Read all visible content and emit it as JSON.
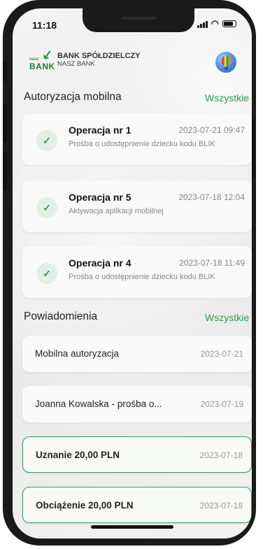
{
  "status": {
    "time": "11:18"
  },
  "bank": {
    "logo_small": "nasz",
    "logo_big": "BANK",
    "name": "BANK SPÓŁDZIELCZY",
    "sub": "NASZ BANK"
  },
  "auth": {
    "title": "Autoryzacja mobilna",
    "link": "Wszystkie",
    "items": [
      {
        "title": "Operacja nr 1",
        "date": "2023-07-21 09:47",
        "desc": "Prośba o udostępnienie dziecku kodu BLIK",
        "status_icon": "check-icon"
      },
      {
        "title": "Operacja nr 5",
        "date": "2023-07-18 12:04",
        "desc": "Aktywacja aplikacji mobilnej",
        "status_icon": "check-icon"
      },
      {
        "title": "Operacja nr 4",
        "date": "2023-07-18 11:49",
        "desc": "Prośba o udostępnienie dziecku kodu BLIK",
        "status_icon": "check-icon"
      }
    ]
  },
  "notifications": {
    "title": "Powiadomienia",
    "link": "Wszystkie",
    "items": [
      {
        "title": "Mobilna autoryzacja",
        "date": "2023-07-21",
        "unread": false
      },
      {
        "title": "Joanna Kowalska - prośba o...",
        "date": "2023-07-19",
        "unread": false
      },
      {
        "title": "Uznanie 20,00 PLN",
        "date": "2023-07-18",
        "unread": true
      },
      {
        "title": "Obciążenie 20,00 PLN",
        "date": "2023-07-18",
        "unread": true
      }
    ]
  },
  "colors": {
    "accent": "#2e9c50",
    "unread_border": "#3a9a5a"
  }
}
